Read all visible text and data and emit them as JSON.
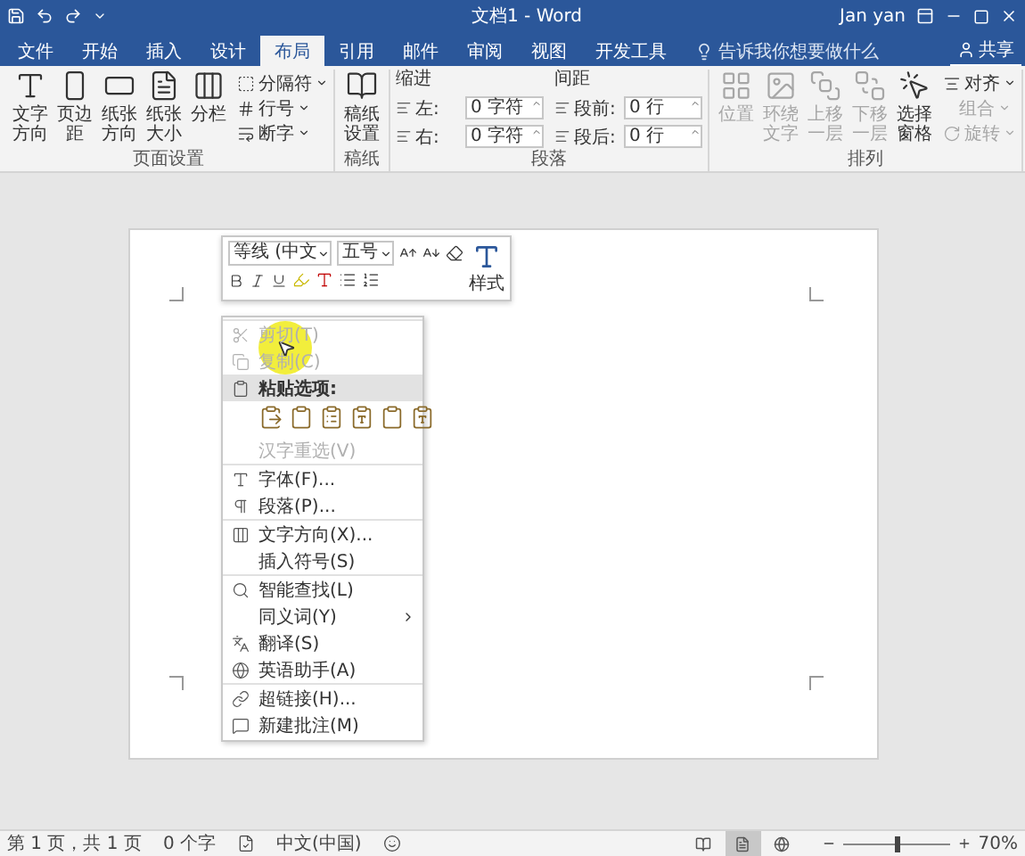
{
  "title_bar": {
    "document_title": "文档1 - Word",
    "user": "Jan yan"
  },
  "tabs": [
    {
      "label": "文件",
      "selected": false
    },
    {
      "label": "开始",
      "selected": false
    },
    {
      "label": "插入",
      "selected": false
    },
    {
      "label": "设计",
      "selected": false
    },
    {
      "label": "布局",
      "selected": true
    },
    {
      "label": "引用",
      "selected": false
    },
    {
      "label": "邮件",
      "selected": false
    },
    {
      "label": "审阅",
      "selected": false
    },
    {
      "label": "视图",
      "selected": false
    },
    {
      "label": "开发工具",
      "selected": false
    }
  ],
  "tell_me": {
    "placeholder": "告诉我你想要做什么"
  },
  "share": "共享",
  "ribbon": {
    "page_setup": {
      "buttons": [
        "文字方向",
        "页边距",
        "纸张方向",
        "纸张大小",
        "分栏"
      ],
      "small_buttons": [
        "分隔符",
        "行号",
        "断字"
      ],
      "label": "页面设置"
    },
    "manuscript": {
      "button": "稿纸设置",
      "label": "稿纸"
    },
    "paragraph": {
      "indent_title": "缩进",
      "spacing_title": "间距",
      "fields": [
        {
          "label": "左:",
          "value": "0 字符"
        },
        {
          "label": "段前:",
          "value": "0 行"
        },
        {
          "label": "右:",
          "value": "0 字符"
        },
        {
          "label": "段后:",
          "value": "0 行"
        }
      ],
      "label": "段落"
    },
    "arrange": {
      "buttons": [
        {
          "label": "位置",
          "disabled": true
        },
        {
          "label": "环绕文字",
          "disabled": true
        },
        {
          "label": "上移一层",
          "disabled": true
        },
        {
          "label": "下移一层",
          "disabled": true
        },
        {
          "label": "选择窗格",
          "disabled": false
        }
      ],
      "small_buttons": [
        {
          "label": "对齐",
          "disabled": false
        },
        {
          "label": "组合",
          "disabled": true
        },
        {
          "label": "旋转",
          "disabled": true
        }
      ],
      "label": "排列"
    }
  },
  "mini_toolbar": {
    "font": "等线 (中文",
    "size": "五号",
    "styles": "样式"
  },
  "context_menu": {
    "sections": [
      [
        {
          "kind": "item",
          "label": "剪切(T)",
          "disabled": true,
          "submenu": false
        },
        {
          "kind": "item",
          "label": "复制(C)",
          "disabled": true,
          "submenu": false
        },
        {
          "kind": "header",
          "label": "粘贴选项:"
        },
        {
          "kind": "paste_options"
        },
        {
          "kind": "item",
          "label": "汉字重选(V)",
          "disabled": true,
          "submenu": false
        }
      ],
      [
        {
          "kind": "item",
          "label": "字体(F)...",
          "disabled": false,
          "submenu": false
        },
        {
          "kind": "item",
          "label": "段落(P)...",
          "disabled": false,
          "submenu": false
        }
      ],
      [
        {
          "kind": "item",
          "label": "文字方向(X)...",
          "disabled": false,
          "submenu": false
        },
        {
          "kind": "item",
          "label": "插入符号(S)",
          "disabled": false,
          "submenu": false
        }
      ],
      [
        {
          "kind": "item",
          "label": "智能查找(L)",
          "disabled": false,
          "submenu": false
        },
        {
          "kind": "item",
          "label": "同义词(Y)",
          "disabled": false,
          "submenu": true
        },
        {
          "kind": "item",
          "label": "翻译(S)",
          "disabled": false,
          "submenu": false
        },
        {
          "kind": "item",
          "label": "英语助手(A)",
          "disabled": false,
          "submenu": false
        }
      ],
      [
        {
          "kind": "item",
          "label": "超链接(H)...",
          "disabled": false,
          "submenu": false
        },
        {
          "kind": "item",
          "label": "新建批注(M)",
          "disabled": false,
          "submenu": false
        }
      ]
    ]
  },
  "status_bar": {
    "page": "第 1 页，共 1 页",
    "words": "0 个字",
    "language": "中文(中国)",
    "views": [
      {
        "selected": false
      },
      {
        "selected": true
      },
      {
        "selected": false
      }
    ],
    "zoom": {
      "level": 0.5,
      "reading": "70%"
    }
  }
}
